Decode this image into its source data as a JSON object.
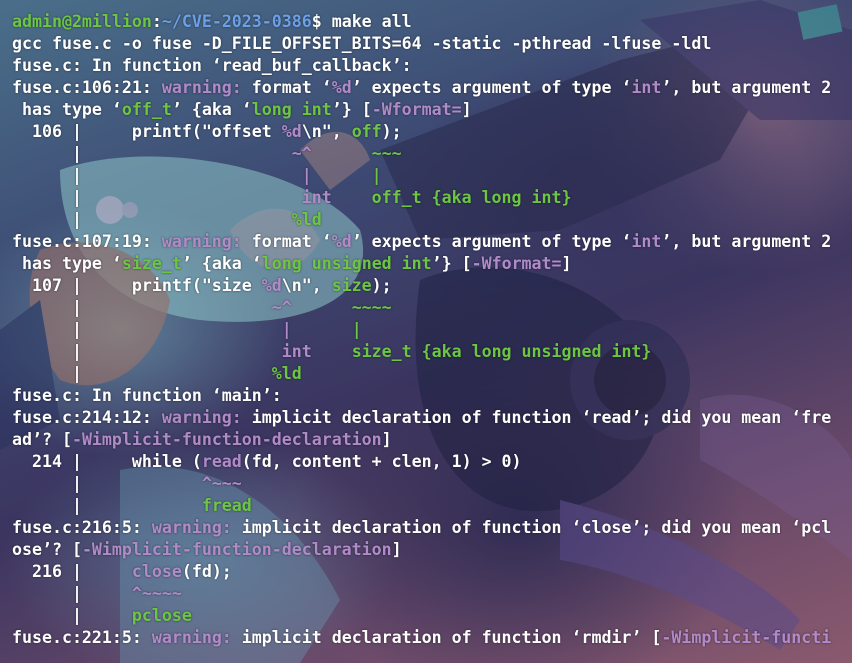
{
  "terminal": {
    "lines": [
      {
        "segments": [
          {
            "text": "admin@2million",
            "color": "green"
          },
          {
            "text": ":",
            "color": "white"
          },
          {
            "text": "~/CVE-2023-0386",
            "color": "blue"
          },
          {
            "text": "$ make all",
            "color": "white"
          }
        ]
      },
      {
        "segments": [
          {
            "text": "gcc fuse.c -o fuse -D_FILE_OFFSET_BITS=64 -static -pthread -lfuse -ldl",
            "color": "white"
          }
        ]
      },
      {
        "segments": [
          {
            "text": "fuse.c: In function ‘read_buf_callback’:",
            "color": "white"
          }
        ]
      },
      {
        "segments": [
          {
            "text": "fuse.c:106:21: ",
            "color": "white"
          },
          {
            "text": "warning: ",
            "color": "magenta"
          },
          {
            "text": "format ‘",
            "color": "white"
          },
          {
            "text": "%d",
            "color": "magenta"
          },
          {
            "text": "’ expects argument of type ‘",
            "color": "white"
          },
          {
            "text": "int",
            "color": "magenta"
          },
          {
            "text": "’, but argument 2",
            "color": "white"
          }
        ]
      },
      {
        "segments": [
          {
            "text": " has type ‘",
            "color": "white"
          },
          {
            "text": "off_t",
            "color": "green"
          },
          {
            "text": "’ {aka ‘",
            "color": "white"
          },
          {
            "text": "long int",
            "color": "green"
          },
          {
            "text": "’} [",
            "color": "white"
          },
          {
            "text": "-Wformat=",
            "color": "magenta"
          },
          {
            "text": "]",
            "color": "white"
          }
        ]
      },
      {
        "segments": [
          {
            "text": "  106 |     printf(\"offset ",
            "color": "white"
          },
          {
            "text": "%d",
            "color": "magenta"
          },
          {
            "text": "\\n\", ",
            "color": "white"
          },
          {
            "text": "off",
            "color": "green"
          },
          {
            "text": ");",
            "color": "white"
          }
        ]
      },
      {
        "segments": [
          {
            "text": "      |                     ",
            "color": "white"
          },
          {
            "text": "~^",
            "color": "magenta"
          },
          {
            "text": "      ",
            "color": "white"
          },
          {
            "text": "~~~",
            "color": "green"
          }
        ]
      },
      {
        "segments": [
          {
            "text": "      |                      ",
            "color": "white"
          },
          {
            "text": "|",
            "color": "magenta"
          },
          {
            "text": "      ",
            "color": "white"
          },
          {
            "text": "|",
            "color": "green"
          }
        ]
      },
      {
        "segments": [
          {
            "text": "      |                      ",
            "color": "white"
          },
          {
            "text": "int",
            "color": "magenta"
          },
          {
            "text": "    ",
            "color": "white"
          },
          {
            "text": "off_t {aka long int}",
            "color": "green"
          }
        ]
      },
      {
        "segments": [
          {
            "text": "      |                     ",
            "color": "white"
          },
          {
            "text": "%ld",
            "color": "green"
          }
        ]
      },
      {
        "segments": [
          {
            "text": "fuse.c:107:19: ",
            "color": "white"
          },
          {
            "text": "warning: ",
            "color": "magenta"
          },
          {
            "text": "format ‘",
            "color": "white"
          },
          {
            "text": "%d",
            "color": "magenta"
          },
          {
            "text": "’ expects argument of type ‘",
            "color": "white"
          },
          {
            "text": "int",
            "color": "magenta"
          },
          {
            "text": "’, but argument 2",
            "color": "white"
          }
        ]
      },
      {
        "segments": [
          {
            "text": " has type ‘",
            "color": "white"
          },
          {
            "text": "size_t",
            "color": "green"
          },
          {
            "text": "’ {aka ‘",
            "color": "white"
          },
          {
            "text": "long unsigned int",
            "color": "green"
          },
          {
            "text": "’} [",
            "color": "white"
          },
          {
            "text": "-Wformat=",
            "color": "magenta"
          },
          {
            "text": "]",
            "color": "white"
          }
        ]
      },
      {
        "segments": [
          {
            "text": "  107 |     printf(\"size ",
            "color": "white"
          },
          {
            "text": "%d",
            "color": "magenta"
          },
          {
            "text": "\\n\", ",
            "color": "white"
          },
          {
            "text": "size",
            "color": "green"
          },
          {
            "text": ");",
            "color": "white"
          }
        ]
      },
      {
        "segments": [
          {
            "text": "      |                   ",
            "color": "white"
          },
          {
            "text": "~^",
            "color": "magenta"
          },
          {
            "text": "      ",
            "color": "white"
          },
          {
            "text": "~~~~",
            "color": "green"
          }
        ]
      },
      {
        "segments": [
          {
            "text": "      |                    ",
            "color": "white"
          },
          {
            "text": "|",
            "color": "magenta"
          },
          {
            "text": "      ",
            "color": "white"
          },
          {
            "text": "|",
            "color": "green"
          }
        ]
      },
      {
        "segments": [
          {
            "text": "      |                    ",
            "color": "white"
          },
          {
            "text": "int",
            "color": "magenta"
          },
          {
            "text": "    ",
            "color": "white"
          },
          {
            "text": "size_t {aka long unsigned int}",
            "color": "green"
          }
        ]
      },
      {
        "segments": [
          {
            "text": "      |                   ",
            "color": "white"
          },
          {
            "text": "%ld",
            "color": "green"
          }
        ]
      },
      {
        "segments": [
          {
            "text": "fuse.c: In function ‘main’:",
            "color": "white"
          }
        ]
      },
      {
        "segments": [
          {
            "text": "fuse.c:214:12: ",
            "color": "white"
          },
          {
            "text": "warning: ",
            "color": "magenta"
          },
          {
            "text": "implicit declaration of function ‘read’; did you mean ‘fre",
            "color": "white"
          }
        ]
      },
      {
        "segments": [
          {
            "text": "ad’? [",
            "color": "white"
          },
          {
            "text": "-Wimplicit-function-declaration",
            "color": "magenta"
          },
          {
            "text": "]",
            "color": "white"
          }
        ]
      },
      {
        "segments": [
          {
            "text": "  214 |     while (",
            "color": "white"
          },
          {
            "text": "read",
            "color": "magenta"
          },
          {
            "text": "(fd, content + clen, 1) > 0)",
            "color": "white"
          }
        ]
      },
      {
        "segments": [
          {
            "text": "      |            ",
            "color": "white"
          },
          {
            "text": "^~~~",
            "color": "magenta"
          }
        ]
      },
      {
        "segments": [
          {
            "text": "      |            ",
            "color": "white"
          },
          {
            "text": "fread",
            "color": "green"
          }
        ]
      },
      {
        "segments": [
          {
            "text": "fuse.c:216:5: ",
            "color": "white"
          },
          {
            "text": "warning: ",
            "color": "magenta"
          },
          {
            "text": "implicit declaration of function ‘close’; did you mean ‘pcl",
            "color": "white"
          }
        ]
      },
      {
        "segments": [
          {
            "text": "ose’? [",
            "color": "white"
          },
          {
            "text": "-Wimplicit-function-declaration",
            "color": "magenta"
          },
          {
            "text": "]",
            "color": "white"
          }
        ]
      },
      {
        "segments": [
          {
            "text": "  216 |     ",
            "color": "white"
          },
          {
            "text": "close",
            "color": "magenta"
          },
          {
            "text": "(fd);",
            "color": "white"
          }
        ]
      },
      {
        "segments": [
          {
            "text": "      |     ",
            "color": "white"
          },
          {
            "text": "^~~~~",
            "color": "magenta"
          }
        ]
      },
      {
        "segments": [
          {
            "text": "      |     ",
            "color": "white"
          },
          {
            "text": "pclose",
            "color": "green"
          }
        ]
      },
      {
        "segments": [
          {
            "text": "fuse.c:221:5: ",
            "color": "white"
          },
          {
            "text": "warning: ",
            "color": "magenta"
          },
          {
            "text": "implicit declaration of function ‘rmdir’ [",
            "color": "white"
          },
          {
            "text": "-Wimplicit-functi",
            "color": "magenta"
          }
        ]
      }
    ]
  },
  "colors": {
    "green": "#6cc644",
    "blue": "#6b9fe8",
    "magenta": "#b18ac9",
    "white": "#ffffff"
  }
}
